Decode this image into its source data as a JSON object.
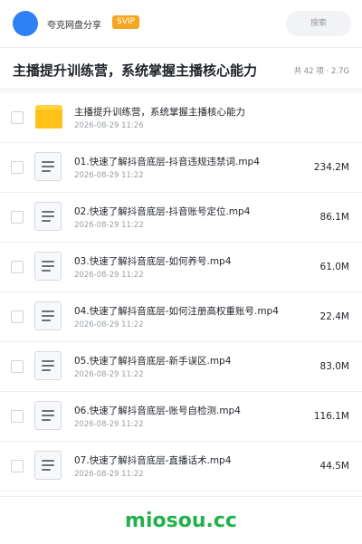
{
  "header": {
    "app_name": "夸克网盘分享",
    "badge": "SVIP",
    "search_label": "搜索"
  },
  "folder": {
    "title": "主播提升训练营，系统掌握主播核心能力",
    "summary": "共 42 项 · 2.7G"
  },
  "items": [
    {
      "type": "folder",
      "icon": "folder-icon",
      "name": "主播提升训练营，系统掌握主播核心能力",
      "date": "2026-08-29 11:26",
      "size": ""
    },
    {
      "type": "file",
      "icon": "document-icon",
      "name": "01.快速了解抖音底层-抖音违规违禁词.mp4",
      "date": "2026-08-29 11:22",
      "size": "234.2M"
    },
    {
      "type": "file",
      "icon": "document-icon",
      "name": "02.快速了解抖音底层-抖音账号定位.mp4",
      "date": "2026-08-29 11:22",
      "size": "86.1M"
    },
    {
      "type": "file",
      "icon": "document-icon",
      "name": "03.快速了解抖音底层-如何养号.mp4",
      "date": "2026-08-29 11:22",
      "size": "61.0M"
    },
    {
      "type": "file",
      "icon": "document-icon",
      "name": "04.快速了解抖音底层-如何注册高权重账号.mp4",
      "date": "2026-08-29 11:22",
      "size": "22.4M"
    },
    {
      "type": "file",
      "icon": "document-icon",
      "name": "05.快速了解抖音底层-新手误区.mp4",
      "date": "2026-08-29 11:22",
      "size": "83.0M"
    },
    {
      "type": "file",
      "icon": "document-icon",
      "name": "06.快速了解抖音底层-账号自检测.mp4",
      "date": "2026-08-29 11:22",
      "size": "116.1M"
    },
    {
      "type": "file",
      "icon": "document-icon",
      "name": "07.快速了解抖音底层-直播话术.mp4",
      "date": "2026-08-29 11:22",
      "size": "44.5M"
    }
  ],
  "watermark": "miosou.cc",
  "colors": {
    "accent": "#2f7ff5",
    "badge": "#f5a623",
    "folder": "#ffc21a",
    "watermark": "#22b14c"
  }
}
